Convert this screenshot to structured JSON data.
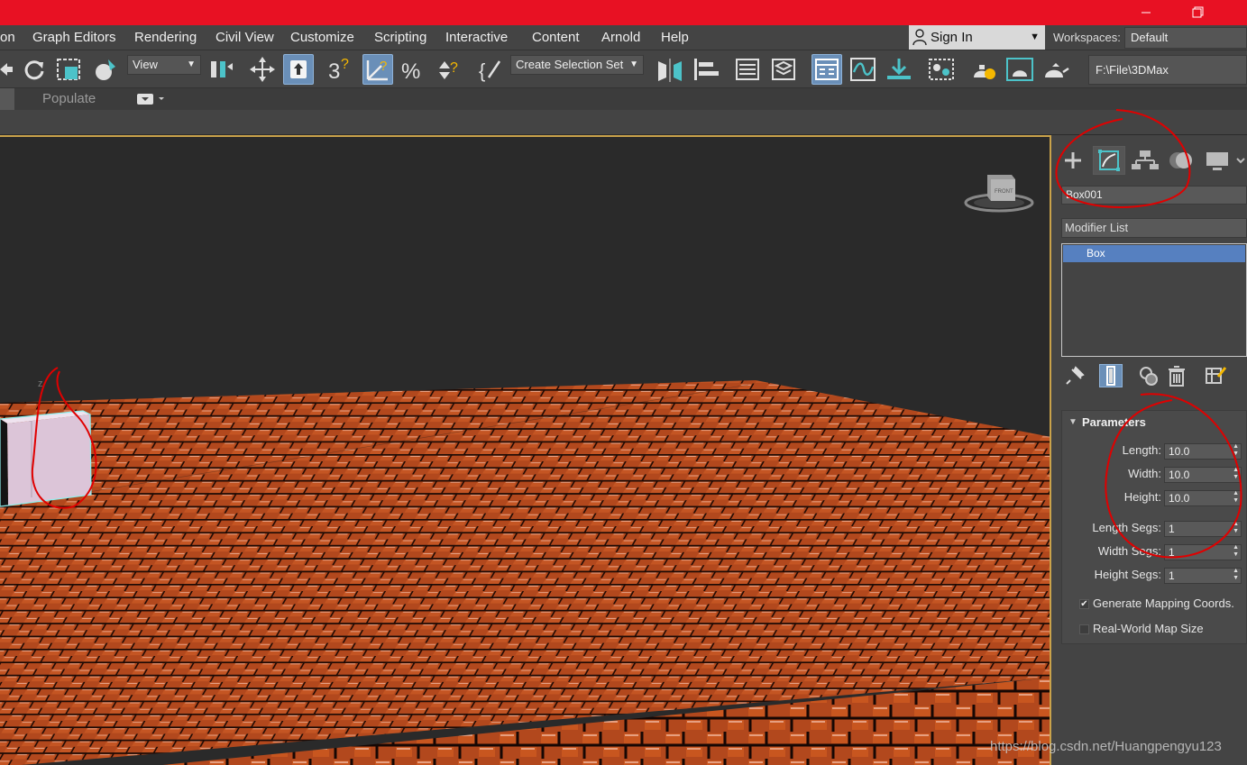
{
  "menu": {
    "items": [
      "on",
      "Graph Editors",
      "Rendering",
      "Civil View",
      "Customize",
      "Scripting",
      "Interactive",
      "Content",
      "Arnold",
      "Help"
    ],
    "sign_in": "Sign In",
    "workspaces_label": "Workspaces:",
    "workspace_value": "Default"
  },
  "toolbar": {
    "reference_coord": "View",
    "selection_set": "Create Selection Set",
    "project_path": "F:\\File\\3DMax"
  },
  "ribbon": {
    "populate": "Populate"
  },
  "viewport": {
    "viewcube_label": "FRONT",
    "axis_label": "z"
  },
  "command_panel": {
    "object_name": "Box001",
    "modifier_list": "Modifier List",
    "stack_item": "Box",
    "rollout_title": "Parameters",
    "params": {
      "length_label": "Length:",
      "length_value": "10.0",
      "width_label": "Width:",
      "width_value": "10.0",
      "height_label": "Height:",
      "height_value": "10.0",
      "length_segs_label": "Length Segs:",
      "length_segs_value": "1",
      "width_segs_label": "Width Segs:",
      "width_segs_value": "1",
      "height_segs_label": "Height Segs:",
      "height_segs_value": "1"
    },
    "generate_mapping": {
      "label": "Generate Mapping Coords.",
      "checked": true,
      "mark": "✔"
    },
    "real_world": {
      "label": "Real-World Map Size",
      "checked": false
    }
  },
  "watermark": "https://blog.csdn.net/Huangpengyu123",
  "colors": {
    "titlebar": "#e81123",
    "accent_active": "#6a8fb8",
    "stack_selected": "#5680c0",
    "annotation": "#e00000",
    "brick": "#b2481d"
  },
  "icons": [
    "minimize-icon",
    "restore-icon",
    "undo-icon",
    "redo-icon",
    "select-region-icon",
    "paint-select-icon",
    "select-move-icon",
    "select-place-icon",
    "snap-3d-icon",
    "angle-snap-icon",
    "percent-snap-icon",
    "spinner-snap-icon",
    "named-selection-icon",
    "mirror-icon",
    "align-icon",
    "scene-explorer-icon",
    "layer-explorer-icon",
    "ribbon-toggle-icon",
    "curve-editor-icon",
    "render-setup-icon",
    "material-editor-icon",
    "render-frame-icon",
    "render-icon",
    "create-icon",
    "modify-icon",
    "hierarchy-icon",
    "motion-icon",
    "display-icon",
    "pin-stack-icon",
    "show-end-result-icon",
    "make-unique-icon",
    "remove-modifier-icon",
    "configure-modifier-sets-icon"
  ]
}
